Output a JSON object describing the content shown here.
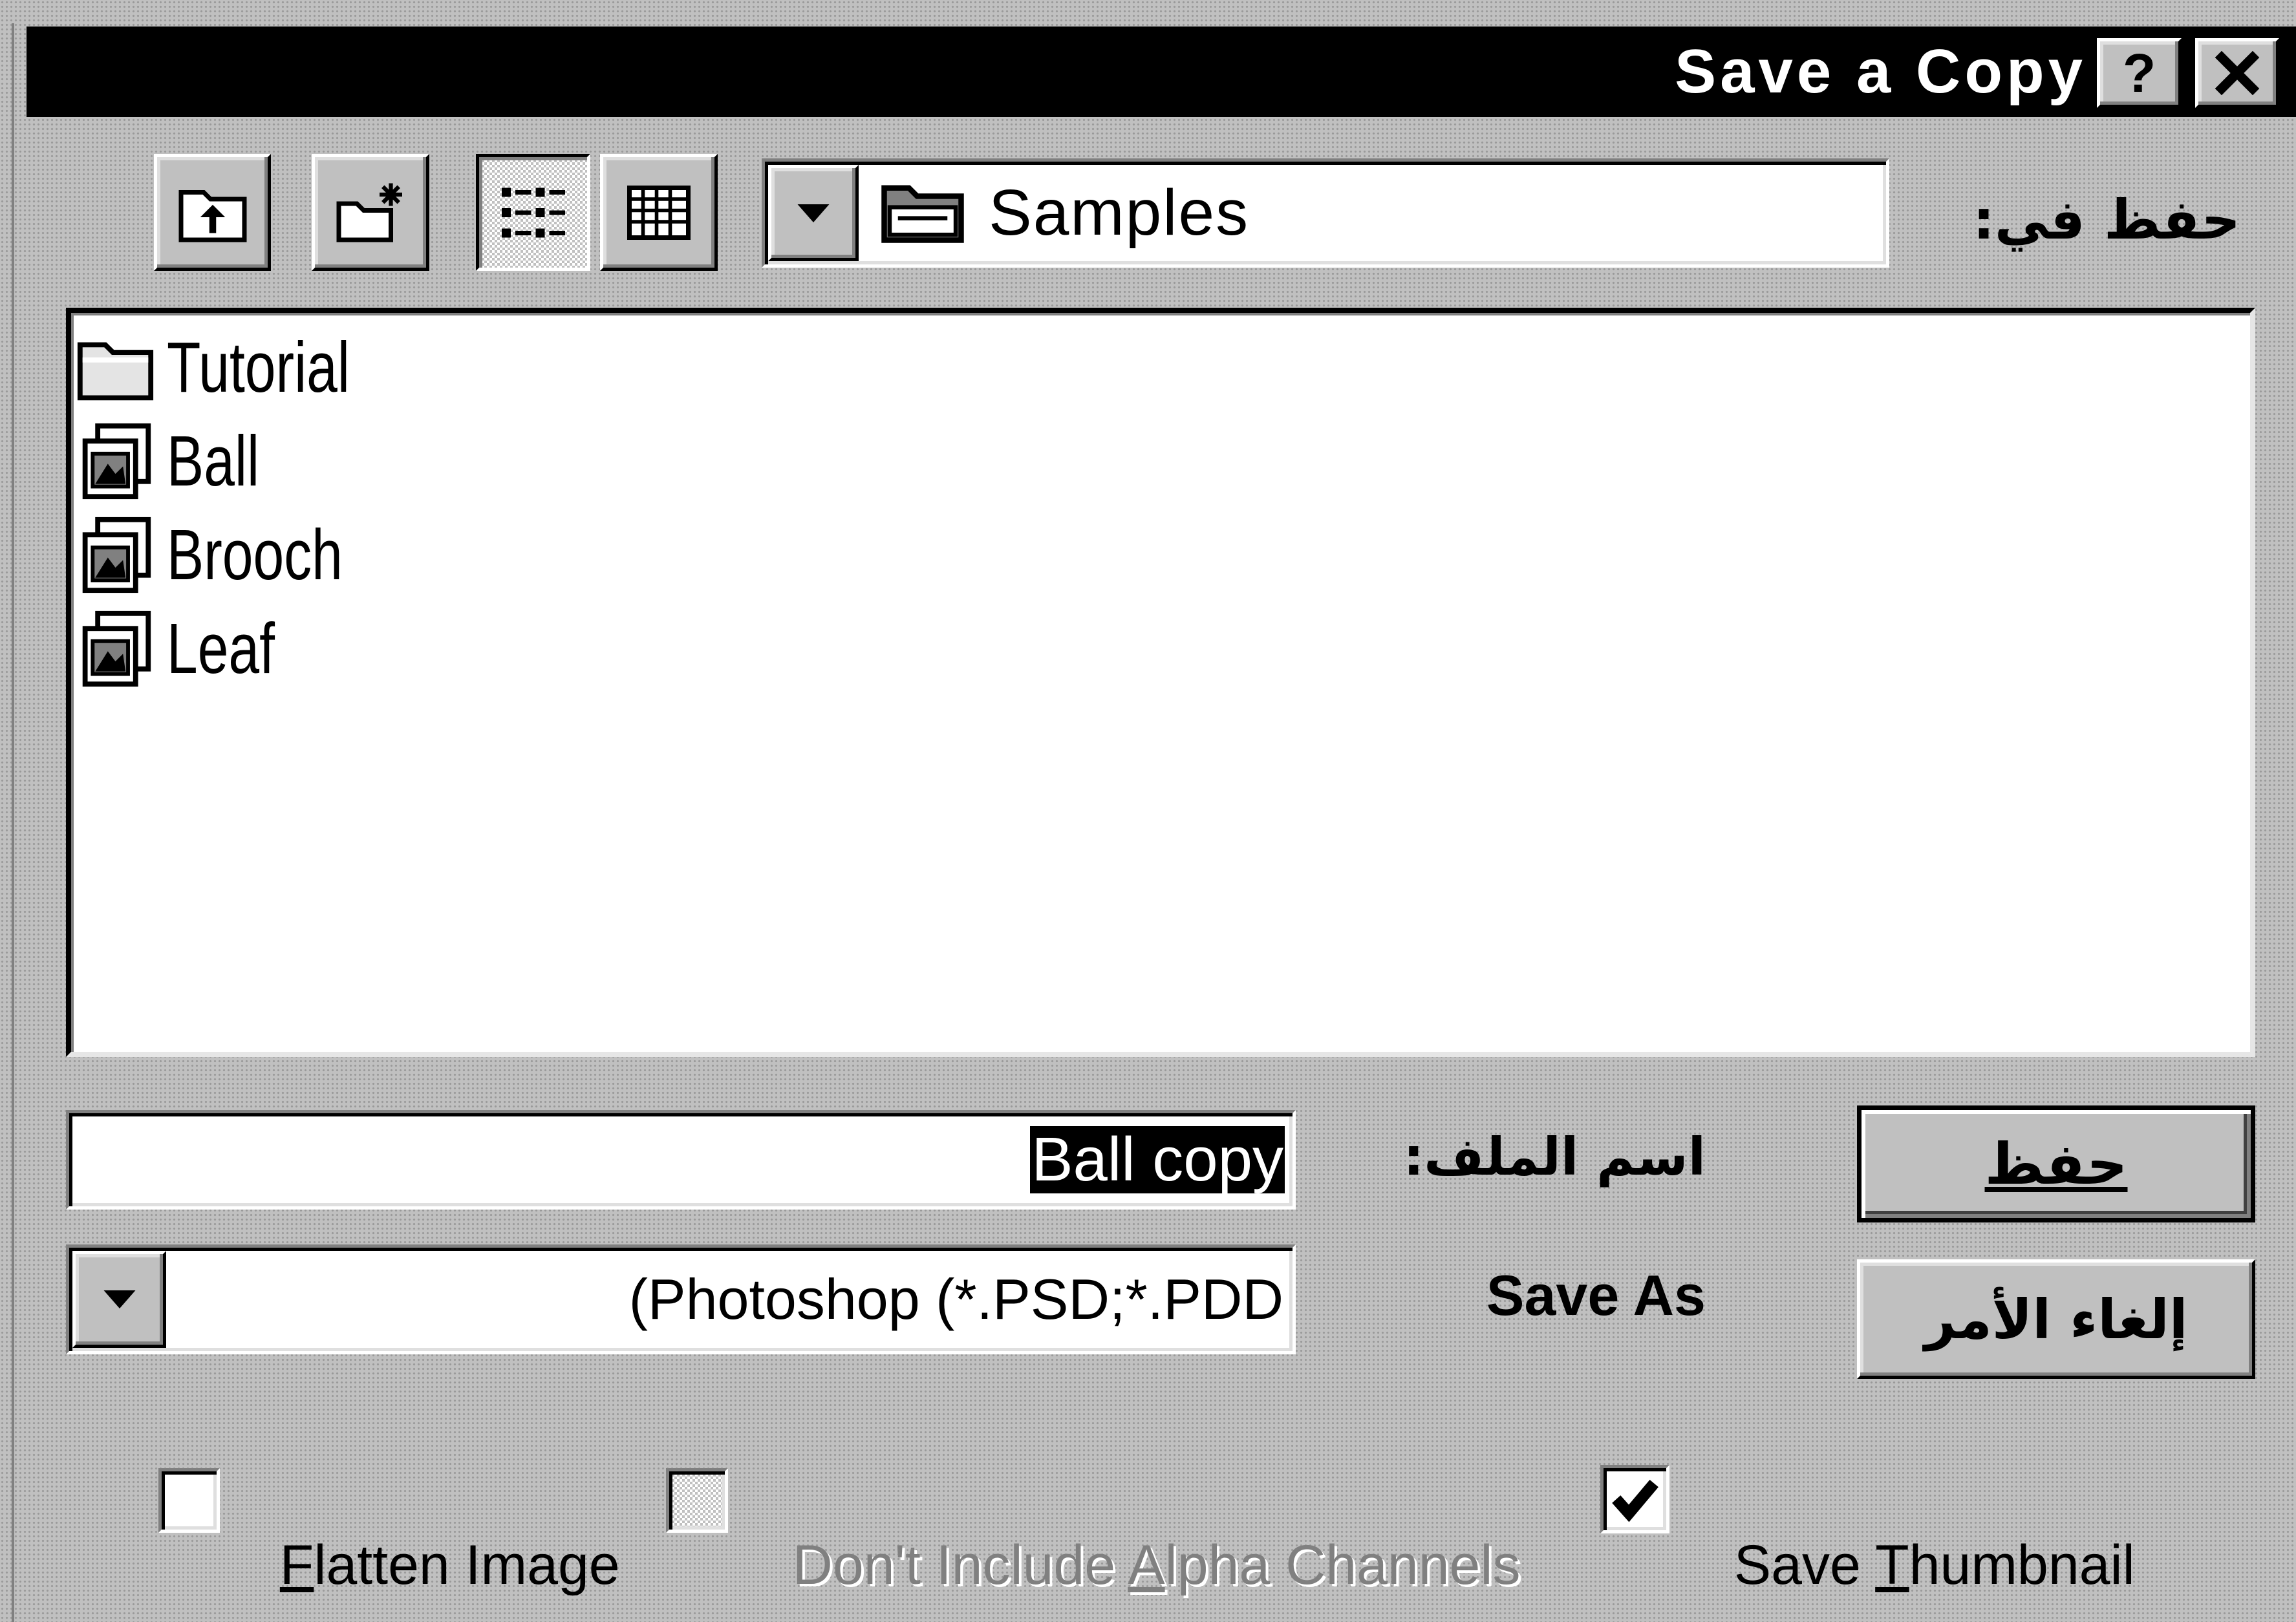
{
  "window": {
    "title": "Save a Copy",
    "help_label": "?",
    "close_icon": "close-icon"
  },
  "toolbar": {
    "save_in_label": "حفظ في:",
    "location": "Samples",
    "location_icon": "folder-icon",
    "buttons": [
      {
        "name": "up-one-level",
        "icon": "up-folder-icon",
        "pressed": false
      },
      {
        "name": "create-new-folder",
        "icon": "new-folder-icon",
        "pressed": false
      },
      {
        "name": "list-view",
        "icon": "list-view-icon",
        "pressed": true
      },
      {
        "name": "details-view",
        "icon": "details-view-icon",
        "pressed": false
      }
    ]
  },
  "file_list": {
    "items": [
      {
        "name": "Tutorial",
        "icon": "folder-icon"
      },
      {
        "name": "Ball",
        "icon": "image-file-icon"
      },
      {
        "name": "Brooch",
        "icon": "image-file-icon"
      },
      {
        "name": "Leaf",
        "icon": "image-file-icon"
      }
    ]
  },
  "file_name": {
    "label": "اسم الملف:",
    "value": "Ball copy",
    "selected": true
  },
  "save_as": {
    "label": "Save As",
    "value": "(Photoshop (*.PSD;*.PDD",
    "dropdown_icon": "chevron-down-icon"
  },
  "actions": {
    "save": "حفظ",
    "cancel": "إلغاء الأمر"
  },
  "options": [
    {
      "before": "",
      "key": "F",
      "after": "latten Image",
      "checked": false,
      "enabled": true
    },
    {
      "before": "Don't Include ",
      "key": "A",
      "after": "lpha Channels",
      "checked": false,
      "enabled": false
    },
    {
      "before": "Save ",
      "key": "T",
      "after": "humbnail",
      "checked": true,
      "enabled": true
    }
  ],
  "colors": {
    "title_bar": "#000000",
    "dialog_face": "#c0c0c0",
    "selection": "#000000",
    "disabled_text": "#808080"
  }
}
